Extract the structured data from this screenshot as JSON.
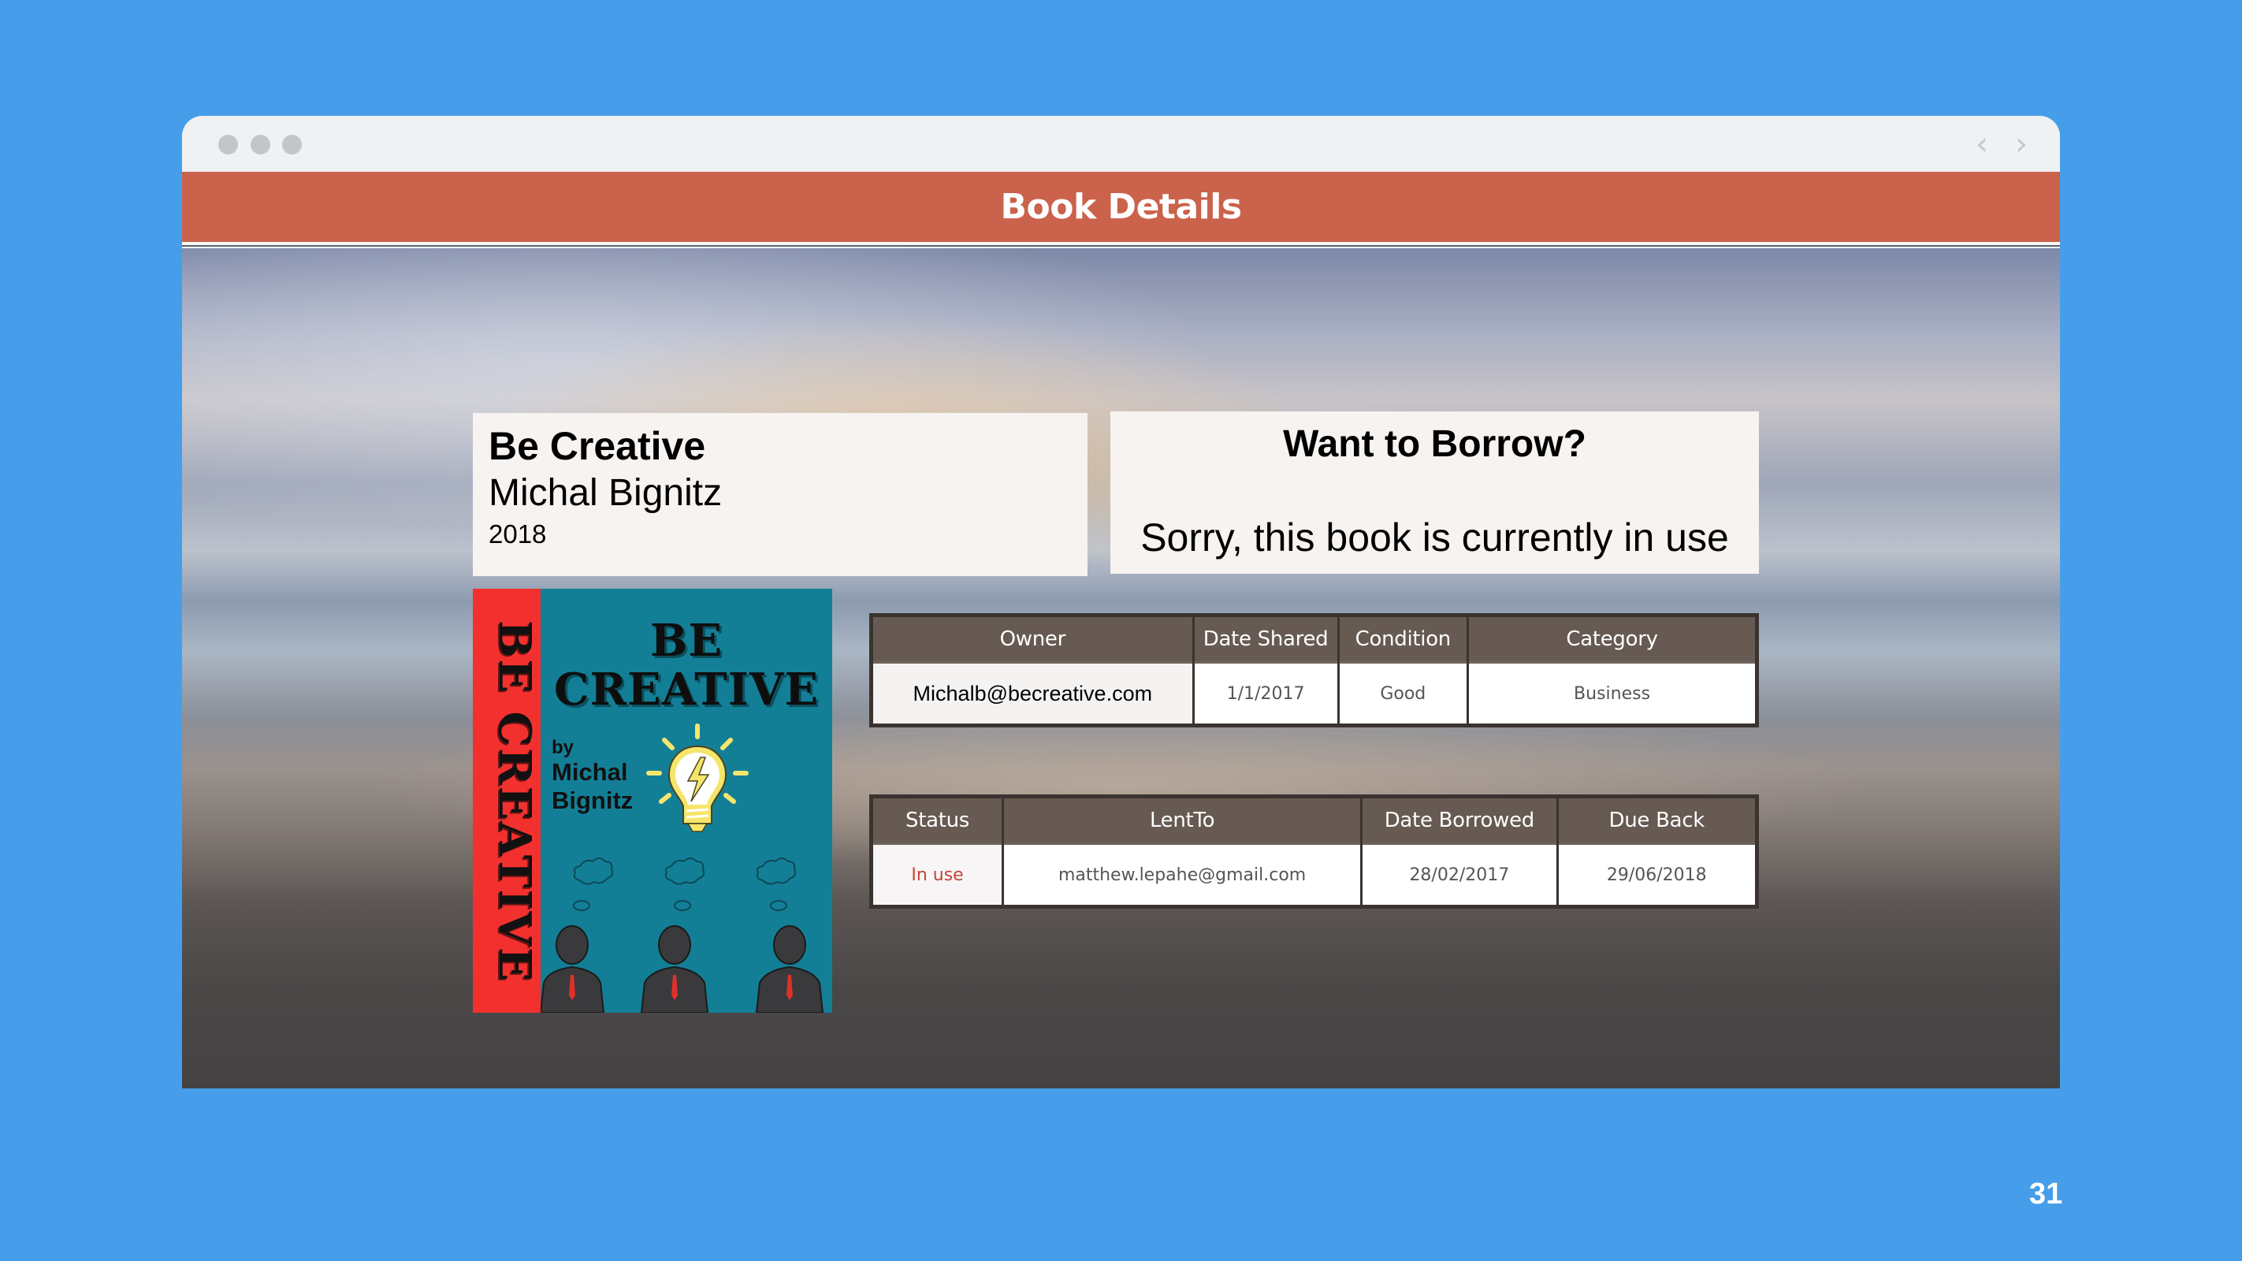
{
  "window": {
    "controls": [
      "close",
      "minimize",
      "maximize"
    ],
    "nav": {
      "back_icon": "‹",
      "forward_icon": "›"
    }
  },
  "header": {
    "title": "Book Details"
  },
  "book": {
    "title": "Be Creative",
    "author": "Michal Bignitz",
    "year": "2018"
  },
  "borrow": {
    "title": "Want to Borrow?",
    "message": "Sorry, this book is currently in use"
  },
  "cover": {
    "spine_text": "BE CREATIVE",
    "title_line1": "BE",
    "title_line2": "CREATIVE",
    "by": "by",
    "author_line1": "Michal",
    "author_line2": "Bignitz",
    "colors": {
      "spine": "#f2312e",
      "background": "#137f96",
      "bulb": "#f5e66b"
    }
  },
  "details_table": {
    "columns": [
      "Owner",
      "Date Shared",
      "Condition",
      "Category"
    ],
    "row": [
      "Michalb@becreative.com",
      "1/1/2017",
      "Good",
      "Business"
    ]
  },
  "loan_table": {
    "columns": [
      "Status",
      "LentTo",
      "Date Borrowed",
      "Due Back"
    ],
    "row": [
      "In use",
      "matthew.lepahe@gmail.com",
      "28/02/2017",
      "29/06/2018"
    ]
  },
  "colors": {
    "page_background": "#469eeb",
    "header": "#cb624b",
    "table_header": "#665a52",
    "status_in_use": "#c0463a"
  },
  "page_number": "31"
}
